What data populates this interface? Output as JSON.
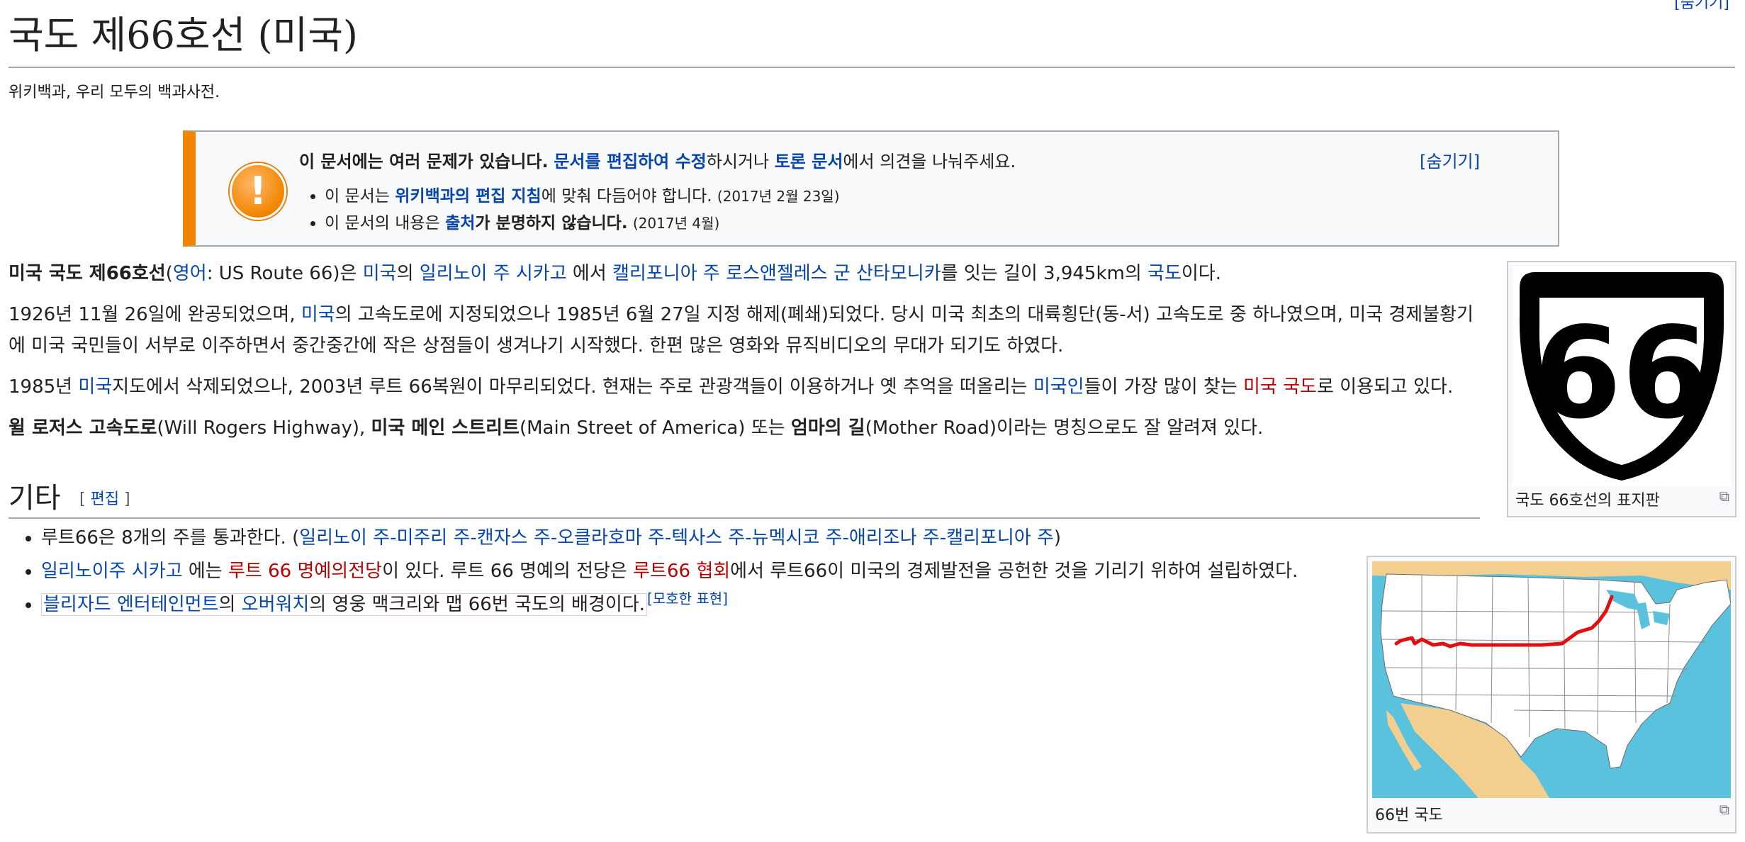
{
  "page": {
    "top_toggle": "[숨기기]",
    "title": "국도 제66호선 (미국)",
    "tagline": "위키백과, 우리 모두의 백과사전."
  },
  "ambox": {
    "head_bold": "이 문서에는 여러 문제가 있습니다.",
    "head_link1": "문서를 편집하여 수정",
    "head_mid": "하시거나",
    "head_link2": "토론 문서",
    "head_end": "에서 의견을 나눠주세요.",
    "hide": "[숨기기]",
    "issue1_pre": "이 문서는",
    "issue1_link": "위키백과의 편집 지침",
    "issue1_post": "에 맞춰 다듬어야 합니다.",
    "issue1_date": "(2017년 2월 23일)",
    "issue2_pre": "이 문서의 내용은",
    "issue2_link": "출처",
    "issue2_post": "가 분명하지 않습니다.",
    "issue2_date": "(2017년 4월)"
  },
  "para1": {
    "bold": "미국 국도 제66호선",
    "open": "(",
    "lang": "영어",
    "colon": ": US Route 66)은 ",
    "usa": "미국",
    "of": "의 ",
    "chicago": "일리노이 주 시카고",
    "from": " 에서 ",
    "santamonica": "캘리포니아 주 로스앤젤레스 군 산타모니카",
    "length": "를 잇는 길이 3,945km의 ",
    "highway": "국도",
    "end": "이다."
  },
  "para2": {
    "pre": "1926년 11월 26일에 완공되었으며, ",
    "usa": "미국",
    "rest": "의 고속도로에 지정되었으나 1985년 6월 27일 지정 해제(폐쇄)되었다. 당시 미국 최초의 대륙횡단(동-서) 고속도로 중 하나였으며, 미국 경제불황기에 미국 국민들이 서부로 이주하면서 중간중간에 작은 상점들이 생겨나기 시작했다. 한편 많은 영화와 뮤직비디오의 무대가 되기도 하였다."
  },
  "para3": {
    "pre": "1985년 ",
    "usa": "미국",
    "mid": "지도에서 삭제되었으나, 2003년 루트 66복원이 마무리되었다. 현재는 주로 관광객들이 이용하거나 옛 추억을 떠올리는 ",
    "americans": "미국인",
    "mid2": "들이 가장 많이 찾는 ",
    "us_highway": "미국 국도",
    "end": "로 이용되고 있다."
  },
  "para4": {
    "b1": "윌 로저스 고속도로",
    "t1": "(Will Rogers Highway), ",
    "b2": "미국 메인 스트리트",
    "t2": "(Main Street of America) 또는 ",
    "b3": "엄마의 길",
    "t3": "(Mother Road)이라는 명칭으로도 잘 알려져 있다."
  },
  "section": {
    "title": "기타",
    "edit_open": "[ ",
    "edit": "편집",
    "edit_close": " ]"
  },
  "misc": {
    "i1_pre": "루트66은 8개의 주를 통과한다. (",
    "i1_states": "일리노이 주-미주리 주-캔자스 주-오클라호마 주-텍사스 주-뉴멕시코 주-애리조나 주-캘리포니아 주",
    "i1_end": ")",
    "i2_chicago": "일리노이주 시카고",
    "i2_t1": " 에는 ",
    "i2_hall": "루트 66 명예의전당",
    "i2_t2": "이 있다. 루트 66 명예의 전당은 ",
    "i2_assoc": "루트66 협회",
    "i2_t3": "에서 루트66이 미국의 경제발전을 공헌한 것을 기리기 위하여 설립하였다.",
    "i3_blizzard": "블리자드 엔터테인먼트",
    "i3_t1": "의 ",
    "i3_ow": "오버워치",
    "i3_t2": "의 영웅 맥크리와 맵 66번 국도의 배경이다.",
    "i3_tag": "[모호한 표현]"
  },
  "infobox": {
    "shield_number": "66",
    "shield_caption": "국도 66호선의 표지판",
    "map_caption": "66번 국도"
  },
  "colors": {
    "link": "#0645ad",
    "redlink": "#ba0000",
    "ambox_accent": "#f28500",
    "map_sea": "#5ac2dc",
    "map_land": "#f3cf8f",
    "route": "#e01010"
  },
  "icons": {
    "ambox": "warning-icon",
    "enlarge": "magnify-icon"
  }
}
